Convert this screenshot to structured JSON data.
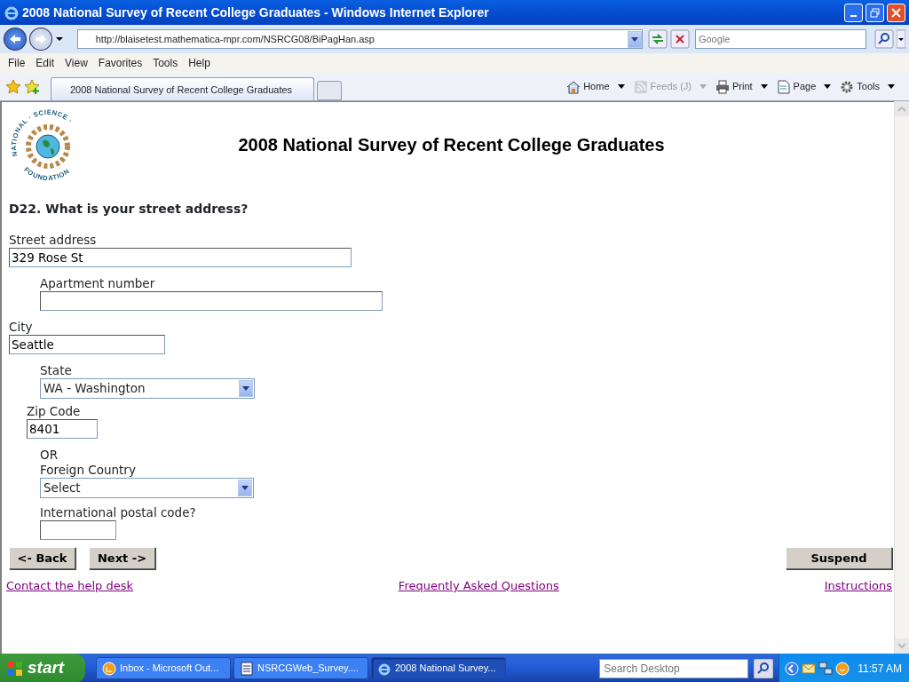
{
  "window": {
    "title": "2008 National Survey of Recent College Graduates - Windows Internet Explorer"
  },
  "address_bar": {
    "url": "http://blaisetest.mathematica-mpr.com/NSRCG08/BiPagHan.asp",
    "search_placeholder": "Google"
  },
  "menu": [
    "File",
    "Edit",
    "View",
    "Favorites",
    "Tools",
    "Help"
  ],
  "tabs": [
    {
      "label": "2008 National Survey of Recent College Graduates",
      "selected": true
    }
  ],
  "command_bar": [
    {
      "kind": "home",
      "label": "Home",
      "disabled": false
    },
    {
      "kind": "feeds",
      "label": "Feeds (J)",
      "disabled": true
    },
    {
      "kind": "print",
      "label": "Print",
      "disabled": false
    },
    {
      "kind": "page",
      "label": "Page",
      "disabled": false
    },
    {
      "kind": "tools",
      "label": "Tools",
      "disabled": false
    }
  ],
  "logo": {
    "top_text": "NATIONAL · SCIENCE ·",
    "bottom_text": "FOUNDATION"
  },
  "heading": "2008 National Survey of Recent College Graduates",
  "question": "D22. What is your street address?",
  "fields": [
    {
      "kind": "text",
      "label": "Street address",
      "value": "329 Rose St"
    },
    {
      "kind": "text",
      "label": "Apartment number"
    },
    {
      "kind": "text",
      "label": "City",
      "value": "Seattle"
    },
    {
      "kind": "select",
      "label": "State",
      "value": "WA - Washington"
    },
    {
      "kind": "text",
      "label": "Zip Code",
      "value": "8401"
    },
    {
      "kind": "select",
      "prefix": "OR",
      "label": "Foreign Country",
      "value": "Select"
    },
    {
      "kind": "text",
      "label": "International postal code?"
    }
  ],
  "buttons": {
    "back": "<- Back",
    "next": "Next ->",
    "suspend": "Suspend"
  },
  "links": [
    "Contact the help desk",
    "Frequently Asked Questions",
    "Instructions"
  ],
  "taskbar": {
    "start": "start",
    "tasks": [
      {
        "kind": "mail",
        "label": "Inbox - Microsoft Out...",
        "selected": false
      },
      {
        "kind": "doc",
        "label": "NSRCGWeb_Survey....",
        "selected": false
      },
      {
        "kind": "ie",
        "label": "2008 National Survey...",
        "selected": true
      }
    ],
    "search_placeholder": "Search Desktop",
    "time": "11:57 AM"
  }
}
